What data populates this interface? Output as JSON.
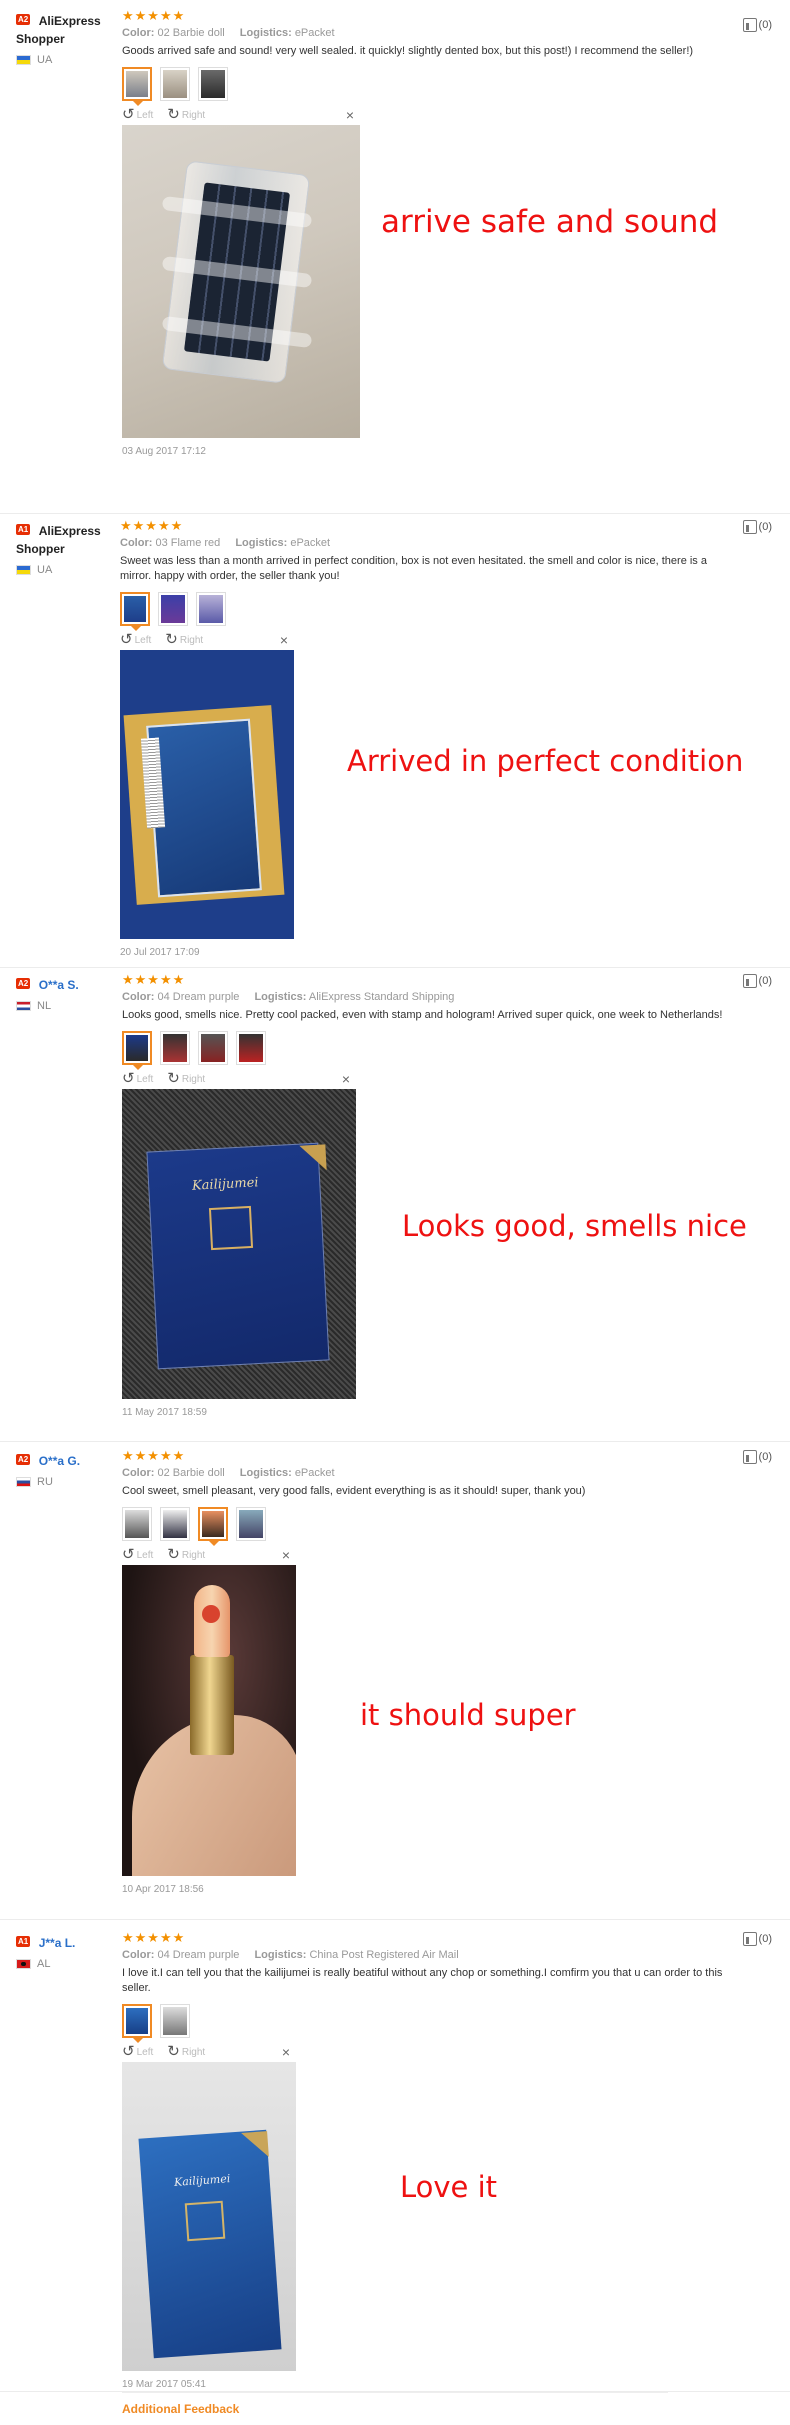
{
  "reviews": [
    {
      "level": "A2",
      "user": "AliExpress Shopper",
      "country": "UA",
      "stars": "★★★★★",
      "color_label": "Color:",
      "color_value": "02 Barbie doll",
      "logistics_label": "Logistics:",
      "logistics_value": "ePacket",
      "text": "Goods arrived safe and sound! very well sealed. it quickly! slightly dented box, but this post!) I recommend the seller!)",
      "rotate_left": "Left",
      "rotate_right": "Right",
      "date": "03 Aug 2017 17:12",
      "helpful": "(0)",
      "caption": "arrive safe and sound"
    },
    {
      "level": "A1",
      "user": "AliExpress Shopper",
      "country": "UA",
      "stars": "★★★★★",
      "color_label": "Color:",
      "color_value": "03 Flame red",
      "logistics_label": "Logistics:",
      "logistics_value": "ePacket",
      "text": "Sweet was less than a month arrived in perfect condition, box is not even hesitated. the smell and color is nice, there is a mirror. happy with order, the seller thank you!",
      "rotate_left": "Left",
      "rotate_right": "Right",
      "date": "20 Jul 2017 17:09",
      "helpful": "(0)",
      "caption": "Arrived in perfect condition"
    },
    {
      "level": "A2",
      "user": "O**a S.",
      "country": "NL",
      "stars": "★★★★★",
      "color_label": "Color:",
      "color_value": "04 Dream purple",
      "logistics_label": "Logistics:",
      "logistics_value": "AliExpress Standard Shipping",
      "text": "Looks good, smells nice. Pretty cool packed, even with stamp and hologram! Arrived super quick, one week to Netherlands!",
      "rotate_left": "Left",
      "rotate_right": "Right",
      "date": "11 May 2017 18:59",
      "helpful": "(0)",
      "caption": "Looks good, smells nice"
    },
    {
      "level": "A2",
      "user": "O**a G.",
      "country": "RU",
      "stars": "★★★★★",
      "color_label": "Color:",
      "color_value": "02 Barbie doll",
      "logistics_label": "Logistics:",
      "logistics_value": "ePacket",
      "text": "Cool sweet, smell pleasant, very good falls, evident everything is as it should! super, thank you)",
      "rotate_left": "Left",
      "rotate_right": "Right",
      "date": "10 Apr 2017 18:56",
      "helpful": "(0)",
      "caption": "it should super"
    },
    {
      "level": "A1",
      "user": "J**a L.",
      "country": "AL",
      "stars": "★★★★★",
      "color_label": "Color:",
      "color_value": "04 Dream purple",
      "logistics_label": "Logistics:",
      "logistics_value": "China Post Registered Air Mail",
      "text": "I love it.I can tell you that the kailijumei is really beatiful without any chop or something.I comfirm you that u can order to this seller.",
      "rotate_left": "Left",
      "rotate_right": "Right",
      "date": "19 Mar 2017 05:41",
      "helpful": "(0)",
      "caption": "Love it"
    }
  ],
  "photo_brand": "Kailijumei",
  "additional_feedback": "Additional Feedback",
  "colors": {
    "stars": "#f39000",
    "caption": "#ee1111",
    "accent": "#f08a24",
    "level": "#e62e04"
  }
}
